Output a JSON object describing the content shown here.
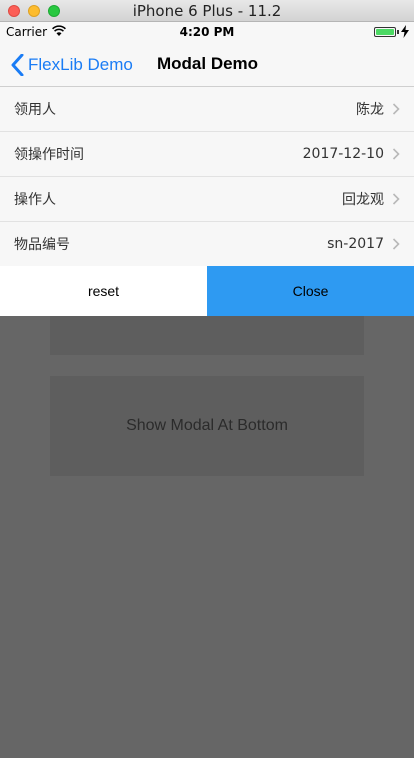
{
  "window": {
    "title": "iPhone 6 Plus - 11.2"
  },
  "status_bar": {
    "carrier": "Carrier",
    "time": "4:20 PM"
  },
  "nav": {
    "back_label": "FlexLib Demo",
    "title": "Modal Demo"
  },
  "form": {
    "rows": [
      {
        "label": "领用人",
        "value": "陈龙"
      },
      {
        "label": "领操作时间",
        "value": "2017-12-10"
      },
      {
        "label": "操作人",
        "value": "回龙观"
      },
      {
        "label": "物品编号",
        "value": "sn-2017"
      }
    ]
  },
  "actions": {
    "reset_label": "reset",
    "close_label": "Close",
    "close_color": "#2e9af2"
  },
  "background": {
    "show_bottom_label": "Show Modal At Bottom",
    "overlay_color": "#666666"
  }
}
